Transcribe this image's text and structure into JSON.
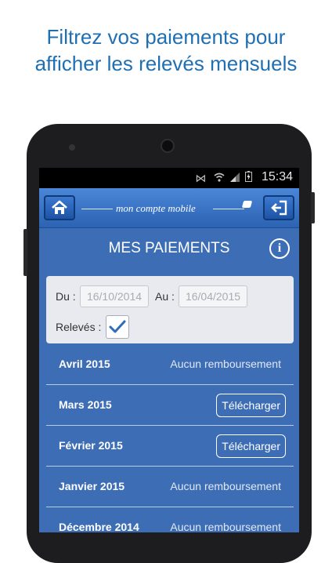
{
  "headline": {
    "line1": "Filtrez vos paiements pour",
    "line2": "afficher les relevés mensuels"
  },
  "statusbar": {
    "time": "15:34",
    "icons": [
      "mute-icon",
      "wifi-icon",
      "signal-icon",
      "battery-charging-icon"
    ]
  },
  "appbar": {
    "brand": "mon compte mobile",
    "icons": [
      "home-icon",
      "logout-icon"
    ]
  },
  "page": {
    "title": "MES PAIEMENTS",
    "info_glyph": "i"
  },
  "filter": {
    "from_label": "Du :",
    "from_value": "16/10/2014",
    "to_label": "Au :",
    "to_value": "16/04/2015",
    "statements_label": "Relevés :",
    "statements_checked": true
  },
  "payments": [
    {
      "month": "Avril 2015",
      "status": "Aucun remboursement"
    },
    {
      "month": "Mars 2015",
      "action": "Télécharger"
    },
    {
      "month": "Février 2015",
      "action": "Télécharger"
    },
    {
      "month": "Janvier 2015",
      "status": "Aucun remboursement"
    },
    {
      "month": "Décembre 2014",
      "status": "Aucun remboursement"
    }
  ],
  "colors": {
    "headline": "#1f6fb3",
    "screen_bg": "#3d6eb5",
    "appbar": "#2c63b3",
    "filter_bg": "#e8eaf0"
  }
}
